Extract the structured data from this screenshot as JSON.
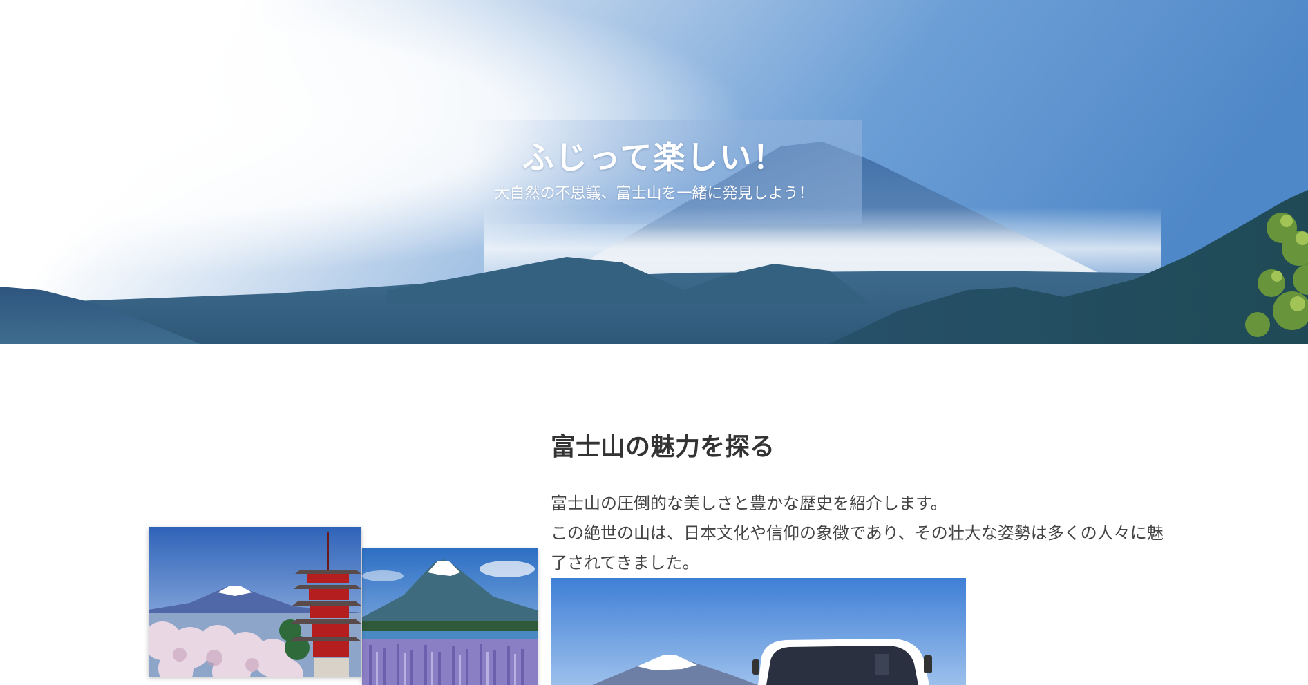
{
  "hero": {
    "title": "ふじって楽しい！",
    "subtitle": "大自然の不思議、富士山を一緒に発見しよう！"
  },
  "intro": {
    "heading": "富士山の魅力を探る",
    "paragraph_line1": "富士山の圧倒的な美しさと豊かな歴史を紹介します。",
    "paragraph_line2": "この絶世の山は、日本文化や信仰の象徴であり、その壮大な姿勢は多くの人々に魅了されてきました。"
  },
  "colors": {
    "sky": "#5a8fcf",
    "mountain": "#2f5f8f",
    "heading": "#333333",
    "body_text": "#444444"
  }
}
